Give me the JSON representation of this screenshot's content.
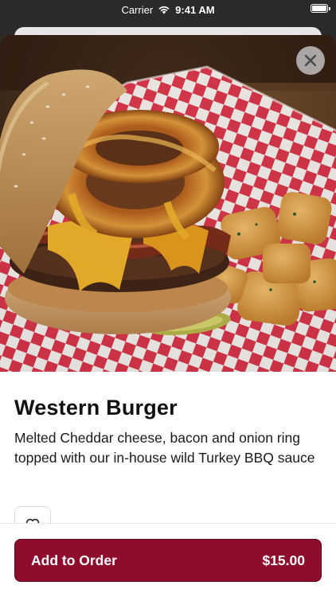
{
  "status_bar": {
    "carrier": "Carrier",
    "time": "9:41 AM",
    "wifi_icon": "wifi-icon",
    "battery_icon": "battery-icon"
  },
  "item": {
    "title": "Western Burger",
    "description": "Melted Cheddar cheese, bacon and onion ring topped with our in-house wild Turkey BBQ sauce",
    "image_icon": "burger-photo"
  },
  "actions": {
    "close_icon": "close-icon",
    "favorite_icon": "heart-icon",
    "add_label": "Add to Order",
    "price": "$15.00"
  },
  "colors": {
    "accent": "#8e0d2c",
    "checker_red": "#d9344a"
  }
}
